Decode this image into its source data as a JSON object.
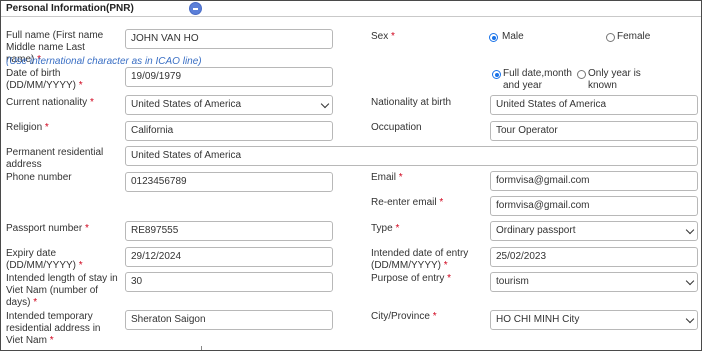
{
  "section": {
    "title": "Personal Information(PNR)"
  },
  "fields": {
    "full_name": {
      "label": "Full name (First name Middle name Last name)",
      "value": "JOHN VAN HO",
      "hint": "(Use international character as in ICAO line)"
    },
    "sex": {
      "label": "Sex",
      "options": [
        "Male",
        "Female"
      ],
      "selected": "Male"
    },
    "dob": {
      "label": "Date of birth (DD/MM/YYYY)",
      "value": "19/09/1979",
      "options": [
        "Full date,month and year",
        "Only year is known"
      ],
      "selected": "Full date,month and year"
    },
    "nationality": {
      "label": "Current nationality",
      "value": "United States of America"
    },
    "nationality_at_birth": {
      "label": "Nationality at birth",
      "value": "United States of America"
    },
    "religion": {
      "label": "Religion",
      "value": "California"
    },
    "occupation": {
      "label": "Occupation",
      "value": "Tour Operator"
    },
    "address": {
      "label": "Permanent residential address",
      "value": "United States of America"
    },
    "phone": {
      "label": "Phone number",
      "value": "0123456789"
    },
    "email": {
      "label": "Email",
      "value": "formvisa@gmail.com"
    },
    "reenter_email": {
      "label": "Re-enter email",
      "value": "formvisa@gmail.com"
    },
    "passport": {
      "label": "Passport number",
      "value": "RE897555"
    },
    "passport_type": {
      "label": "Type",
      "value": "Ordinary passport"
    },
    "expiry": {
      "label": "Expiry date (DD/MM/YYYY)",
      "value": "29/12/2024"
    },
    "entry_date": {
      "label": "Intended date of entry (DD/MM/YYYY)",
      "value": "25/02/2023"
    },
    "stay_length": {
      "label": "Intended length of stay in Viet Nam (number of days)",
      "value": "30"
    },
    "purpose": {
      "label": "Purpose of entry",
      "value": "tourism"
    },
    "temp_address": {
      "label": "Intended temporary residential address in Viet Nam",
      "value": "Sheraton Saigon"
    },
    "city": {
      "label": "City/Province",
      "value": "HO CHI MINH City"
    }
  },
  "required_mark": "*"
}
